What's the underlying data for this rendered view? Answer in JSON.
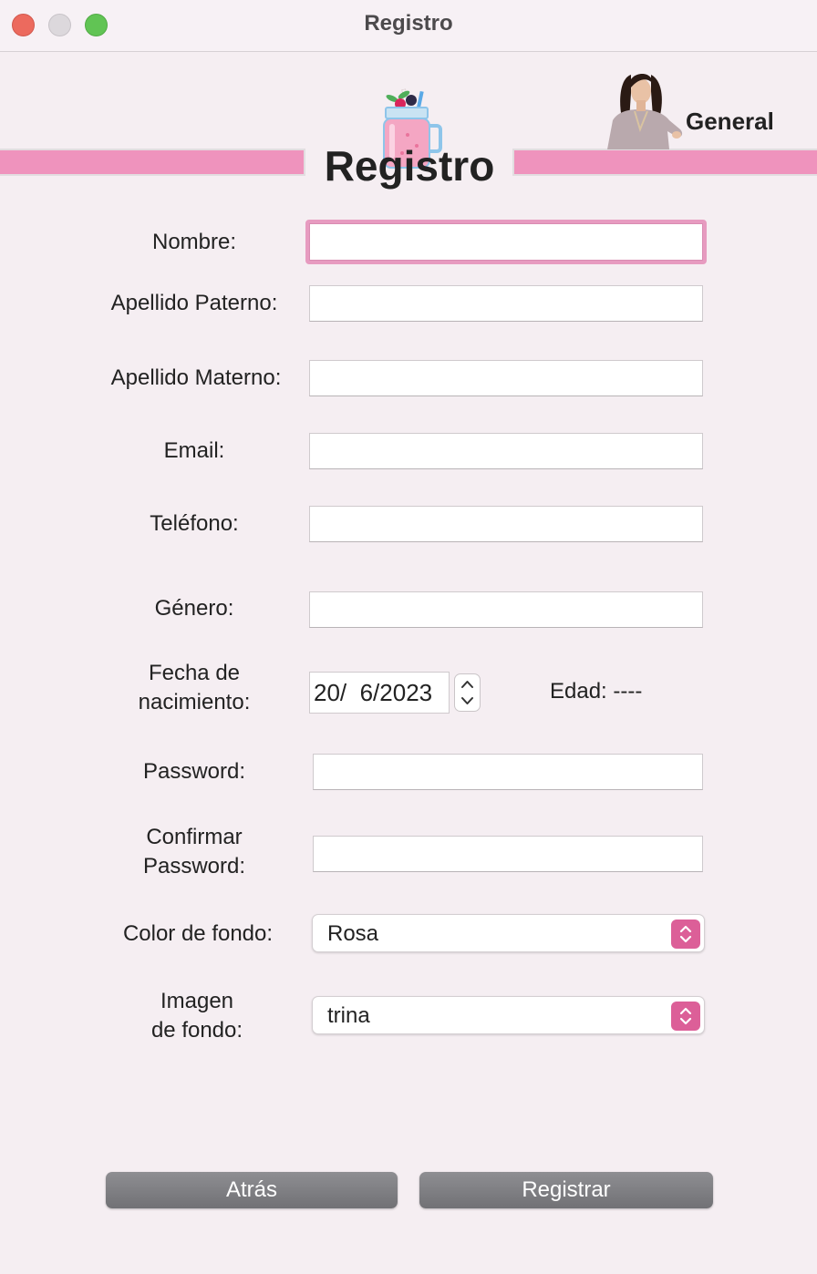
{
  "window": {
    "title": "Registro"
  },
  "header": {
    "heading": "Registro",
    "profile_label": "General"
  },
  "form": {
    "nombre_label": "Nombre:",
    "nombre_value": "",
    "apellido_paterno_label": "Apellido Paterno:",
    "apellido_paterno_value": "",
    "apellido_materno_label": "Apellido Materno:",
    "apellido_materno_value": "",
    "email_label": "Email:",
    "email_value": "",
    "telefono_label": "Teléfono:",
    "telefono_value": "",
    "genero_label": "Género:",
    "genero_value": "",
    "fecha_label_line1": "Fecha de",
    "fecha_label_line2": "nacimiento:",
    "fecha_value": "20/  6/2023",
    "edad_text": "Edad: ----",
    "password_label": "Password:",
    "confirmar_label_line1": "Confirmar",
    "confirmar_label_line2": "Password:",
    "color_label": "Color de fondo:",
    "color_value": "Rosa",
    "imagen_label_line1": "Imagen",
    "imagen_label_line2": "de fondo:",
    "imagen_value": "trina"
  },
  "buttons": {
    "back_label": "Atrás",
    "register_label": "Registrar"
  },
  "colors": {
    "accent": "#ef93bd",
    "select_accent": "#dc5f98",
    "button_gray": "#7d7d81",
    "background": "#f5eef2"
  },
  "icons": {
    "decoration": "smoothie-jar-icon",
    "profile": "profile-photo"
  }
}
